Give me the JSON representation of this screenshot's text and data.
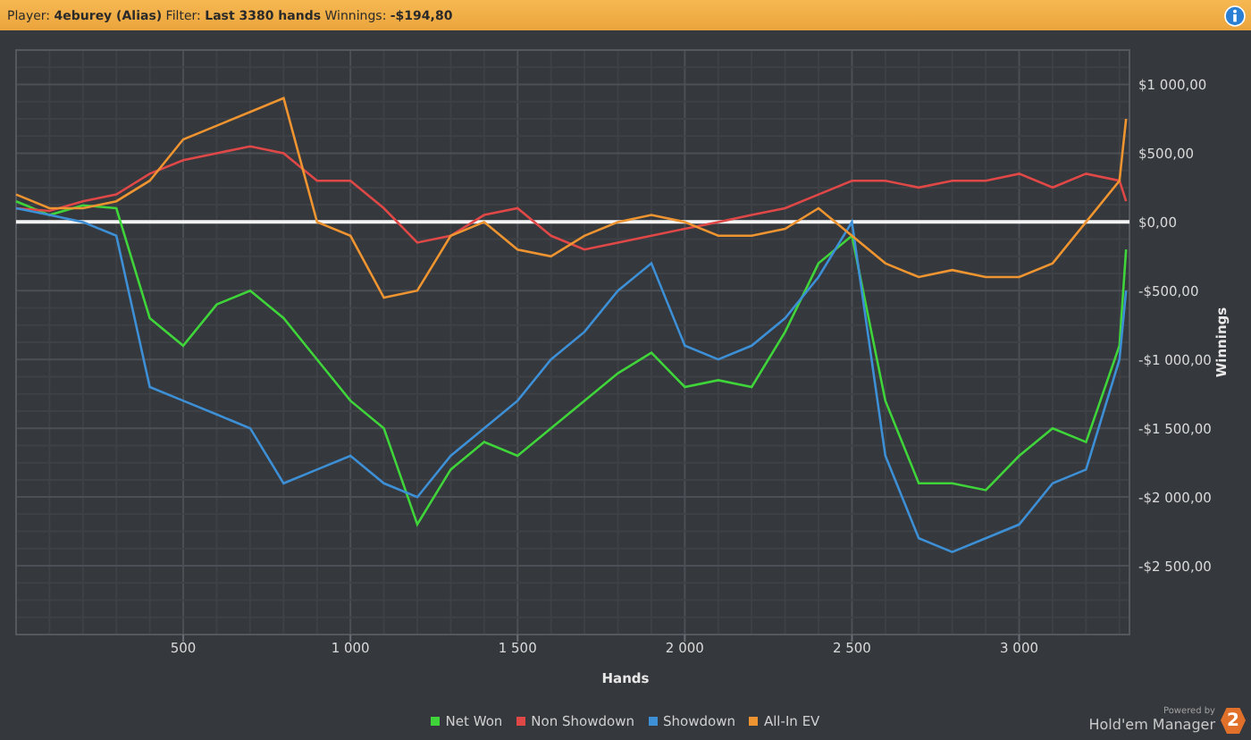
{
  "header": {
    "summary": "Player: **4eburey (Alias)** Filter: **Last 3380 hands** Winnings: **-$194,80**"
  },
  "chart": {
    "chart_data": {
      "type": "line",
      "xlabel": "Hands",
      "ylabel": "Winnings",
      "x": [
        0,
        100,
        200,
        300,
        400,
        500,
        600,
        700,
        800,
        900,
        1000,
        1100,
        1200,
        1300,
        1400,
        1500,
        1600,
        1700,
        1800,
        1900,
        2000,
        2100,
        2200,
        2300,
        2400,
        2500,
        2600,
        2700,
        2800,
        2900,
        3000,
        3100,
        3200,
        3300,
        3320
      ],
      "series": [
        {
          "name": "Net Won",
          "color": "#3fd53a",
          "values": [
            150,
            50,
            120,
            100,
            -700,
            -900,
            -600,
            -500,
            -700,
            -1000,
            -1300,
            -1500,
            -2200,
            -1800,
            -1600,
            -1700,
            -1500,
            -1300,
            -1100,
            -950,
            -1200,
            -1150,
            -1200,
            -800,
            -300,
            -100,
            -1300,
            -1900,
            -1900,
            -1950,
            -1700,
            -1500,
            -1600,
            -900,
            -200
          ]
        },
        {
          "name": "Non Showdown",
          "color": "#e04848",
          "values": [
            100,
            80,
            150,
            200,
            350,
            450,
            500,
            550,
            500,
            300,
            300,
            100,
            -150,
            -100,
            50,
            100,
            -100,
            -200,
            -150,
            -100,
            -50,
            0,
            50,
            100,
            200,
            300,
            300,
            250,
            300,
            300,
            350,
            250,
            350,
            300,
            150
          ]
        },
        {
          "name": "Showdown",
          "color": "#3d8fd6",
          "values": [
            100,
            50,
            0,
            -100,
            -1200,
            -1300,
            -1400,
            -1500,
            -1900,
            -1800,
            -1700,
            -1900,
            -2000,
            -1700,
            -1500,
            -1300,
            -1000,
            -800,
            -500,
            -300,
            -900,
            -1000,
            -900,
            -700,
            -400,
            0,
            -1700,
            -2300,
            -2400,
            -2300,
            -2200,
            -1900,
            -1800,
            -1000,
            -500
          ]
        },
        {
          "name": "All-In EV",
          "color": "#ee9430",
          "values": [
            200,
            100,
            100,
            150,
            300,
            600,
            700,
            800,
            900,
            0,
            -100,
            -550,
            -500,
            -100,
            0,
            -200,
            -250,
            -100,
            0,
            50,
            0,
            -100,
            -100,
            -50,
            100,
            -100,
            -300,
            -400,
            -350,
            -400,
            -400,
            -300,
            0,
            300,
            750
          ]
        }
      ],
      "grid": true,
      "xlim": [
        0,
        3330
      ],
      "ylim": [
        -3000,
        1250
      ],
      "xticks": [
        {
          "value": 500,
          "label": "500"
        },
        {
          "value": 1000,
          "label": "1 000"
        },
        {
          "value": 1500,
          "label": "1 500"
        },
        {
          "value": 2000,
          "label": "2 000"
        },
        {
          "value": 2500,
          "label": "2 500"
        },
        {
          "value": 3000,
          "label": "3 000"
        }
      ],
      "yticks": [
        {
          "value": 1000,
          "label": "$1 000,00"
        },
        {
          "value": 500,
          "label": "$500,00"
        },
        {
          "value": 0,
          "label": "$0,00"
        },
        {
          "value": -500,
          "label": "-$500,00"
        },
        {
          "value": -1000,
          "label": "-$1 000,00"
        },
        {
          "value": -1500,
          "label": "-$1 500,00"
        },
        {
          "value": -2000,
          "label": "-$2 000,00"
        },
        {
          "value": -2500,
          "label": "-$2 500,00"
        }
      ]
    }
  },
  "branding": {
    "powered_by": "Powered by",
    "product": "Hold'em Manager",
    "badge": "2"
  }
}
